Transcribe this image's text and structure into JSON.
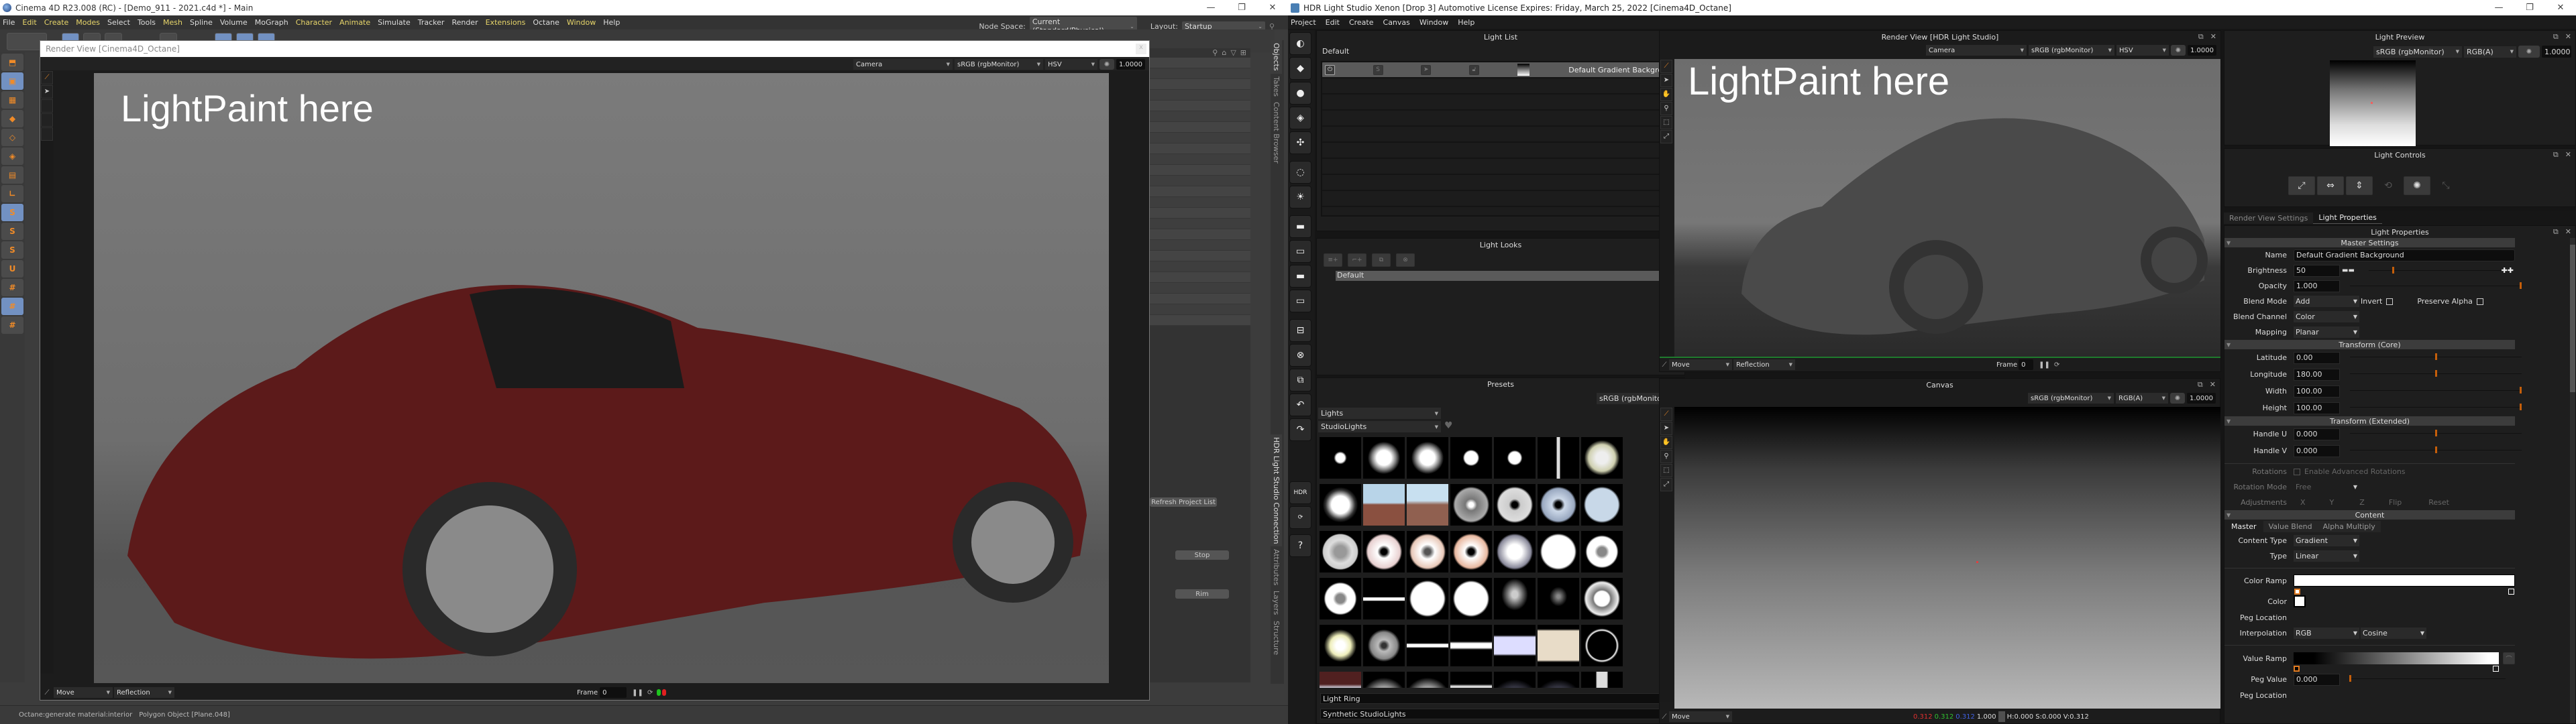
{
  "c4d": {
    "title": "Cinema 4D R23.008 (RC) - [Demo_911 - 2021.c4d *] - Main",
    "menu": [
      "File",
      "Edit",
      "Create",
      "Modes",
      "Select",
      "Tools",
      "Mesh",
      "Spline",
      "Volume",
      "MoGraph",
      "Character",
      "Animate",
      "Simulate",
      "Tracker",
      "Render",
      "Extensions",
      "Octane",
      "Window",
      "Help"
    ],
    "menu_highlighted": [
      1,
      2,
      3,
      6,
      10,
      11,
      15,
      17
    ],
    "node_space_label": "Node Space:",
    "node_space_value": "Current (Standard/Physical)",
    "layout_label": "Layout:",
    "layout_value": "Startup",
    "window_buttons": {
      "minimize": "—",
      "maximize": "❐",
      "close": "✕"
    },
    "render_view": {
      "title": "Render View [Cinema4D_Octane]",
      "camera": "Camera",
      "color_space": "sRGB (rgbMonitor)",
      "mode": "HSV",
      "exposure": "1.0000",
      "overlay_text": "LightPaint here",
      "paint_mode": "Move",
      "paint_type": "Reflection",
      "frame_label": "Frame",
      "frame_value": "0"
    },
    "side_tabs_top": [
      "Objects",
      "Takes",
      "Content Browser"
    ],
    "side_tabs_bottom": [
      "HDR Light Studio Connection",
      "Attributes",
      "Layers",
      "Structure"
    ],
    "connection_buttons": {
      "refresh": "Refresh Project List",
      "stop": "Stop",
      "rim": "Rim"
    },
    "status": {
      "left": "Octane:generate material:interior",
      "right": "Polygon Object [Plane.048]"
    }
  },
  "hls": {
    "title": "HDR Light Studio Xenon [Drop 3] Automotive License Expires: Friday, March 25, 2022  [Cinema4D_Octane]",
    "menu": [
      "Project",
      "Edit",
      "Create",
      "Canvas",
      "Window",
      "Help"
    ],
    "light_list": {
      "title": "Light List",
      "group": "Default",
      "items": [
        "Default Gradient Background"
      ]
    },
    "light_looks": {
      "title": "Light Looks",
      "items": [
        "Default"
      ]
    },
    "presets": {
      "title": "Presets",
      "color_space": "sRGB (rgbMonitor)",
      "category": "Lights",
      "subcategory": "StudioLights",
      "selected_name": "Light Ring",
      "selected_collection": "Synthetic StudioLights",
      "hdr_label": "HDR"
    },
    "render_view": {
      "title": "Render View [HDR Light Studio]",
      "camera": "Camera",
      "color_space": "sRGB (rgbMonitor)",
      "mode": "HSV",
      "exposure": "1.0000",
      "overlay_text": "LightPaint here",
      "paint_mode": "Move",
      "paint_type": "Reflection",
      "frame_label": "Frame",
      "frame_value": "0"
    },
    "canvas": {
      "title": "Canvas",
      "color_space": "sRGB (rgbMonitor)",
      "channel": "RGB(A)",
      "exposure": "1.0000",
      "paint_mode": "Move",
      "readout": {
        "r": "0.312",
        "g": "0.312",
        "b": "0.312",
        "a": "1.000",
        "hsv": "H:0.000 S:0.000 V:0.312"
      }
    },
    "light_preview": {
      "title": "Light Preview",
      "color_space": "sRGB (rgbMonitor)",
      "channel": "RGB(A)",
      "exposure": "1.0000"
    },
    "light_controls": {
      "title": "Light Controls"
    },
    "tabs": [
      "Render View Settings",
      "Light Properties"
    ],
    "light_properties": {
      "title": "Light Properties",
      "master_settings": "Master Settings",
      "name_label": "Name",
      "name_value": "Default Gradient Background",
      "brightness_label": "Brightness",
      "brightness_value": "50",
      "opacity_label": "Opacity",
      "opacity_value": "1.000",
      "blend_mode_label": "Blend Mode",
      "blend_mode_value": "Add",
      "invert_label": "Invert",
      "preserve_alpha_label": "Preserve Alpha",
      "blend_channel_label": "Blend Channel",
      "blend_channel_value": "Color",
      "mapping_label": "Mapping",
      "mapping_value": "Planar",
      "transform_core": "Transform (Core)",
      "latitude_label": "Latitude",
      "latitude_value": "0.00",
      "longitude_label": "Longitude",
      "longitude_value": "180.00",
      "width_label": "Width",
      "width_value": "100.00",
      "height_label": "Height",
      "height_value": "100.00",
      "transform_extended": "Transform (Extended)",
      "handle_u_label": "Handle U",
      "handle_u_value": "0.000",
      "handle_v_label": "Handle V",
      "handle_v_value": "0.000",
      "rotations_label": "Rotations",
      "enable_adv_rot": "Enable Advanced Rotations",
      "rotation_mode_label": "Rotation Mode",
      "rotation_mode_value": "Free",
      "adjustments_label": "Adjustments",
      "adj_x": "X",
      "adj_y": "Y",
      "adj_z": "Z",
      "flip": "Flip",
      "reset": "Reset",
      "content": "Content",
      "content_tabs": [
        "Master",
        "Value Blend",
        "Alpha Multiply"
      ],
      "content_type_label": "Content Type",
      "content_type_value": "Gradient",
      "type_label": "Type",
      "type_value": "Linear",
      "color_ramp_label": "Color Ramp",
      "color_label": "Color",
      "peg_location_label": "Peg Location",
      "interpolation_label": "Interpolation",
      "interpolation_value": "RGB",
      "interpolation_curve": "Cosine",
      "value_ramp_label": "Value Ramp",
      "peg_value_label": "Peg Value",
      "peg_value_value": "0.000",
      "sliders": {
        "brightness": 0.18,
        "opacity": 1.0,
        "latitude": 0.5,
        "longitude": 0.5,
        "width": 1.0,
        "height": 1.0,
        "handle_u": 0.5,
        "handle_v": 0.5,
        "peg_value": 0.0
      }
    }
  },
  "colors": {
    "accent_orange": "#c55e0a",
    "green_bar": "#1f7a2d",
    "readout_r": "#e03030",
    "readout_g": "#30c030",
    "readout_b": "#4060e0"
  }
}
